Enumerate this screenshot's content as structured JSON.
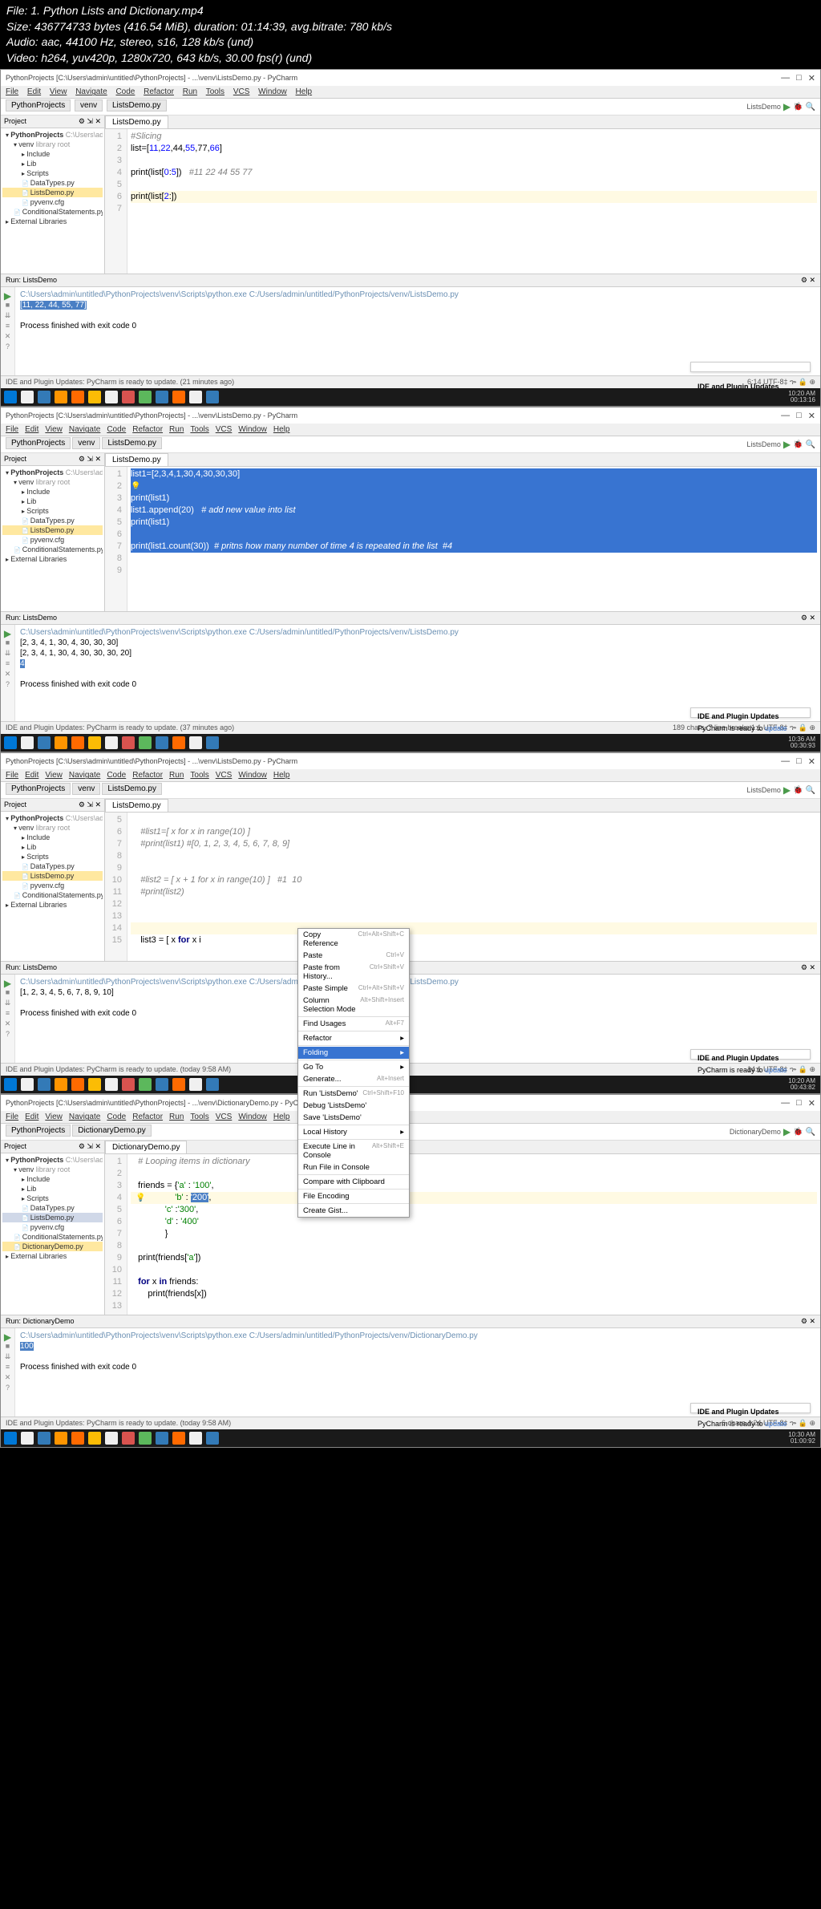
{
  "meta": {
    "file": "File: 1. Python Lists and Dictionary.mp4",
    "size": "Size: 436774733 bytes (416.54 MiB), duration: 01:14:39, avg.bitrate: 780 kb/s",
    "audio": "Audio: aac, 44100 Hz, stereo, s16, 128 kb/s (und)",
    "video": "Video: h264, yuv420p, 1280x720, 643 kb/s, 30.00 fps(r) (und)"
  },
  "menu": {
    "items": [
      "File",
      "Edit",
      "View",
      "Navigate",
      "Code",
      "Refactor",
      "Run",
      "Tools",
      "VCS",
      "Window",
      "Help"
    ]
  },
  "proj_label": "Project",
  "run_cfg": "ListsDemo",
  "run_cfg4": "DictionaryDemo",
  "title": {
    "s1": "PythonProjects [C:\\Users\\admin\\untitled\\PythonProjects] - ...\\venv\\ListsDemo.py - PyCharm",
    "s4": "PythonProjects [C:\\Users\\admin\\untitled\\PythonProjects] - ...\\venv\\DictionaryDemo.py - PyCharm"
  },
  "crumb": {
    "proj": "PythonProjects",
    "venv": "venv",
    "f_lists": "ListsDemo.py",
    "f_dict": "DictionaryDemo.py"
  },
  "tree": {
    "root": "PythonProjects",
    "rootpath": "C:\\Users\\admin\\untitled\\Py",
    "venv": "venv",
    "venvinfo": "library root",
    "items": [
      "Include",
      "Lib",
      "Scripts",
      "DataTypes.py",
      "ListsDemo.py",
      "pyvenv.cfg",
      "ConditionalStatements.py"
    ],
    "items4": [
      "Include",
      "Lib",
      "Scripts",
      "DataTypes.py",
      "ListsDemo.py",
      "pyvenv.cfg",
      "ConditionalStatements.py",
      "DictionaryDemo.py"
    ],
    "ext": "External Libraries"
  },
  "tab": {
    "lists": "ListsDemo.py",
    "dict": "DictionaryDemo.py"
  },
  "code1": {
    "l1": "#Slicing",
    "l2_a": "list=[",
    "l2_b": "11",
    "l2_c": ",",
    "l2_d": "22",
    "l2_e": ",44,",
    "l2_f": "55",
    "l2_g": ",77,",
    "l2_h": "66",
    "l2_i": "]",
    "l4_a": "print(list[",
    "l4_b": "0",
    "l4_c": ":",
    "l4_d": "5",
    "l4_e": "])   ",
    "l4_f": "#11 22 44 55 77",
    "l6_a": "print(list[",
    "l6_b": "2",
    "l6_c": ":",
    "l6_d": "])   "
  },
  "code2": {
    "l1a": "list1=[",
    "l1b": "2",
    "l1c": ",3,",
    "l1d": "4",
    "l1e": ",1,",
    "l1f": "30",
    "l1g": ",4,",
    "l1h": "30",
    "l1i": ",30,",
    "l1j": "30",
    "l1k": "]",
    "l3": "print(list1)",
    "l4a": "list1.append(",
    "l4b": "20",
    "l4c": ")   ",
    "l4d": "# add new value into list",
    "l5": "print(list1)",
    "l7a": "print(list1.count(",
    "l7b": "30",
    "l7c": "))  ",
    "l7d": "# pritns how many number of time 4 is repeated in the list  #4"
  },
  "code3": {
    "l6": "#list1=[ x for x in range(10) ]",
    "l7": "#print(list1) #[0, 1, 2, 3, 4, 5, 6, 7, 8, 9]",
    "l10": "#list2 = [ x + 1 for x in range(10) ]   #1  10",
    "l11": "#print(list2)",
    "l15a": "list3 = [ x ",
    "l15b": "for",
    "l15c": " x i"
  },
  "code4": {
    "l1": "# Looping items in dictionary",
    "l3a": "friends = {",
    "l3b": "'a'",
    "l3c": " : ",
    "l3d": "'100'",
    "l3e": ",",
    "l4a": "           ",
    "l4b": "'b'",
    "l4c": " : ",
    "l4d": "'200'",
    "l4e": ",",
    "l5a": "           ",
    "l5b": "'c'",
    "l5c": " :",
    "l5d": "'300'",
    "l5e": ",",
    "l6a": "           ",
    "l6b": "'d'",
    "l6c": " : ",
    "l6d": "'400'",
    "l7": "           }",
    "l9a": "print(friends[",
    "l9b": "'a'",
    "l9c": "])",
    "l11a": "for",
    "l11b": " x ",
    "l11c": "in",
    "l11d": " friends:",
    "l12a": "    print(friends[x])"
  },
  "ctx": {
    "copy_ref": "Copy Reference",
    "copy_ref_sc": "Ctrl+Alt+Shift+C",
    "paste": "Paste",
    "paste_sc": "Ctrl+V",
    "paste_hist": "Paste from History...",
    "paste_hist_sc": "Ctrl+Shift+V",
    "paste_simple": "Paste Simple",
    "paste_simple_sc": "Ctrl+Alt+Shift+V",
    "col_sel": "Column Selection Mode",
    "col_sel_sc": "Alt+Shift+Insert",
    "find_usages": "Find Usages",
    "find_usages_sc": "Alt+F7",
    "refactor": "Refactor",
    "folding": "Folding",
    "goto": "Go To",
    "generate": "Generate...",
    "generate_sc": "Alt+Insert",
    "run": "Run 'ListsDemo'",
    "run_sc": "Ctrl+Shift+F10",
    "debug": "Debug 'ListsDemo'",
    "save": "Save 'ListsDemo'",
    "local_hist": "Local History",
    "exec_line": "Execute Line in Console",
    "exec_line_sc": "Alt+Shift+E",
    "run_file": "Run File in Console",
    "compare": "Compare with Clipboard",
    "file_enc": "File Encoding",
    "create_gist": "Create Gist..."
  },
  "run_label": "Run:",
  "out": {
    "path1": "C:\\Users\\admin\\untitled\\PythonProjects\\venv\\Scripts\\python.exe C:/Users/admin/untitled/PythonProjects/venv/ListsDemo.py",
    "r1": "[11, 22, 44, 55, 77]",
    "exit": "Process finished with exit code 0",
    "r2a": "[2, 3, 4, 1, 30, 4, 30, 30, 30]",
    "r2b": "[2, 3, 4, 1, 30, 4, 30, 30, 30, 20]",
    "r2c": "4",
    "r3": "[1, 2, 3, 4, 5, 6, 7, 8, 9, 10]",
    "path4": "C:\\Users\\admin\\untitled\\PythonProjects\\venv\\Scripts\\python.exe C:/Users/admin/untitled/PythonProjects/venv/DictionaryDemo.py",
    "r4": "100"
  },
  "notif": {
    "title": "IDE and Plugin Updates",
    "msg": "PyCharm is ready to ",
    "link": "update"
  },
  "status": {
    "s1": "IDE and Plugin Updates: PyCharm is ready to update. (21 minutes ago)",
    "s1r": "6:14    UTF-8‡   ኈ   🔒  ⊕",
    "s2": "IDE and Plugin Updates: PyCharm is ready to update. (37 minutes ago)",
    "s2r": "189 chars, 7 line breaks   1:1    UTF-8‡   ኈ   🔒  ⊕",
    "s3": "IDE and Plugin Updates: PyCharm is ready to update. (today 9:58 AM)",
    "s3r": "14:1    UTF-8‡   ኈ   🔒  ⊕",
    "s4r": "6 chars   4:24    UTF-8‡   ኈ   🔒  ⊕"
  },
  "time": {
    "t1": "10:20 AM",
    "t2": "10:36 AM",
    "t3": "10:20 AM",
    "t4": "10:30 AM"
  },
  "ts": {
    "t1": "00:13:16",
    "t2": "00:30:93",
    "t3": "00:43:82",
    "t4": "01:00:92"
  },
  "console_name": {
    "lists": "ListsDemo",
    "dict": "DictionaryDemo"
  }
}
